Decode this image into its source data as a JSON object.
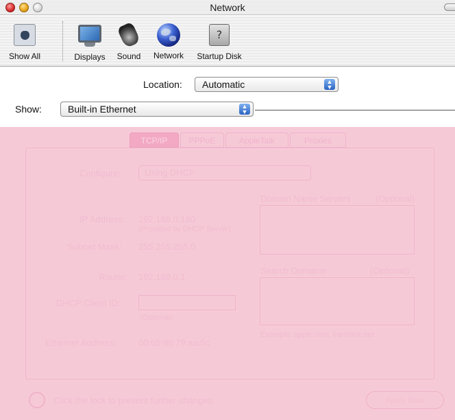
{
  "window": {
    "title": "Network"
  },
  "toolbar": {
    "items": [
      {
        "label": "Show All",
        "icon": "show-all-icon"
      },
      {
        "label": "Displays",
        "icon": "display-icon"
      },
      {
        "label": "Sound",
        "icon": "speaker-icon"
      },
      {
        "label": "Network",
        "icon": "globe-icon"
      },
      {
        "label": "Startup Disk",
        "icon": "startup-disk-icon"
      }
    ]
  },
  "location": {
    "label": "Location:",
    "value": "Automatic"
  },
  "show": {
    "label": "Show:",
    "value": "Built-in Ethernet"
  },
  "tabs": [
    {
      "label": "TCP/IP",
      "selected": true
    },
    {
      "label": "PPPoE",
      "selected": false
    },
    {
      "label": "AppleTalk",
      "selected": false
    },
    {
      "label": "Proxies",
      "selected": false
    }
  ],
  "tcpip": {
    "configure_label": "Configure:",
    "configure_value": "Using DHCP",
    "ip_label": "IP Address:",
    "ip_value": "192.168.0.180",
    "ip_note": "(Provided by DHCP Server)",
    "subnet_label": "Subnet Mask:",
    "subnet_value": "255.255.255.0",
    "router_label": "Router:",
    "router_value": "192.168.0.1",
    "dhcp_label": "DHCP Client ID:",
    "dhcp_note": "(Optional)",
    "ethernet_label": "Ethernet Address:",
    "ethernet_value": "00:05:96:79:aa:5c",
    "dns_label": "Domain Name Servers",
    "dns_optional": "(Optional)",
    "search_label": "Search Domains",
    "search_optional": "(Optional)",
    "example": "Example: apple.com, earthlink.net"
  },
  "footer": {
    "lock_text": "Click the lock to prevent further changes.",
    "apply_label": "Apply Now"
  },
  "colors": {
    "overlay": "#f6c9d7",
    "accent": "#2a63c2"
  }
}
